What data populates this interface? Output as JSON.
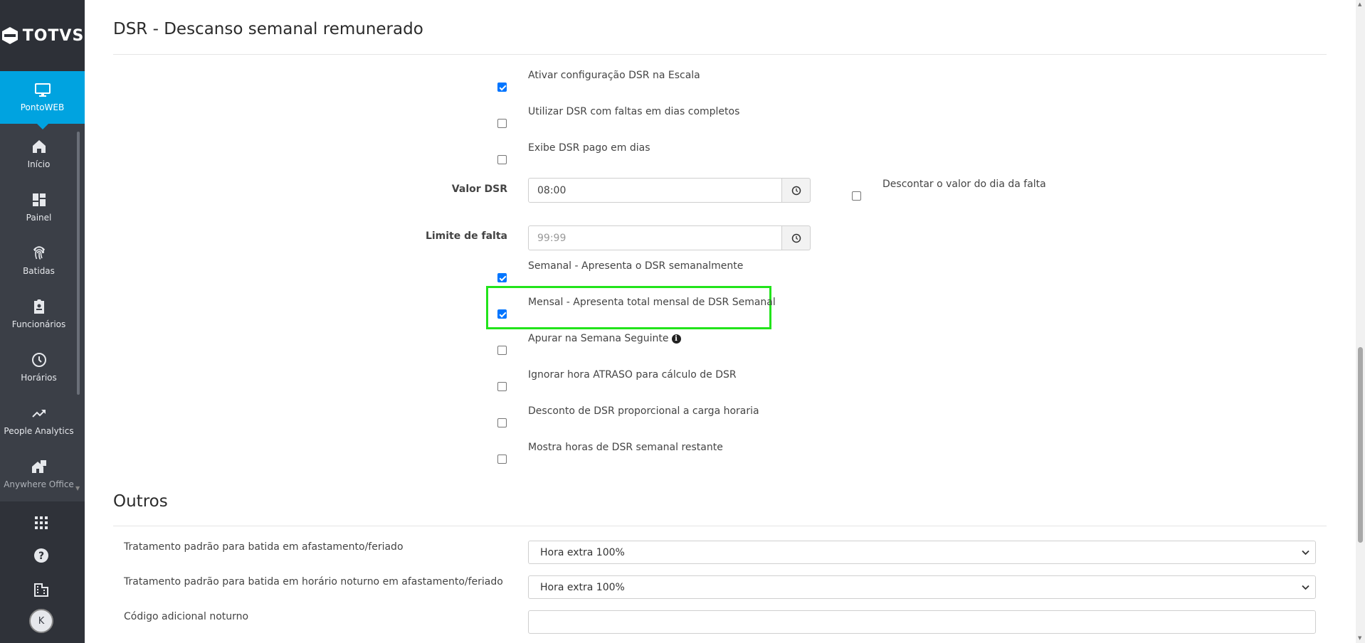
{
  "app": {
    "logo_text": "TOTVS",
    "active_module": "PontoWEB"
  },
  "sidebar": {
    "items": [
      {
        "label": "Início",
        "icon": "home-icon"
      },
      {
        "label": "Painel",
        "icon": "dashboard-icon"
      },
      {
        "label": "Batidas",
        "icon": "fingerprint-icon"
      },
      {
        "label": "Funcionários",
        "icon": "badge-icon"
      },
      {
        "label": "Horários",
        "icon": "clock-icon"
      },
      {
        "label": "People Analytics",
        "icon": "trending-up-icon"
      },
      {
        "label": "Anywhere Office",
        "icon": "home-work-icon"
      }
    ],
    "bottom": {
      "apps_icon": "apps-grid-icon",
      "help_icon": "help-icon",
      "company_icon": "building-icon",
      "avatar_initial": "K"
    }
  },
  "dsr": {
    "title": "DSR - Descanso semanal remunerado",
    "options_top": [
      {
        "label": "Ativar configuração DSR na Escala",
        "checked": true
      },
      {
        "label": "Utilizar DSR com faltas em dias completos",
        "checked": false
      },
      {
        "label": "Exibe DSR pago em dias",
        "checked": false
      }
    ],
    "valor_dsr": {
      "label": "Valor DSR",
      "value": "08:00"
    },
    "descontar": {
      "label": "Descontar o valor do dia da falta",
      "checked": false
    },
    "limite_falta": {
      "label": "Limite de falta",
      "placeholder": "99:99"
    },
    "options_bottom": [
      {
        "label": "Semanal - Apresenta o DSR semanalmente",
        "checked": true
      },
      {
        "label": "Mensal - Apresenta total mensal de DSR Semanal",
        "checked": true
      },
      {
        "label": "Apurar na Semana Seguinte",
        "checked": false,
        "info": true
      },
      {
        "label": "Ignorar hora ATRASO para cálculo de DSR",
        "checked": false
      },
      {
        "label": "Desconto de DSR proporcional a carga horaria",
        "checked": false
      },
      {
        "label": "Mostra horas de DSR semanal restante",
        "checked": false
      }
    ]
  },
  "outros": {
    "title": "Outros",
    "rows": [
      {
        "label": "Tratamento padrão para batida em afastamento/feriado",
        "value": "Hora extra 100%"
      },
      {
        "label": "Tratamento padrão para batida em horário noturno em afastamento/feriado",
        "value": "Hora extra 100%"
      },
      {
        "label": "Código adicional noturno",
        "value": ""
      }
    ]
  },
  "colors": {
    "accent": "#00a3e0",
    "sidebar": "#3b3f47",
    "highlight": "#22e41b",
    "checkbox": "#0075ff"
  }
}
